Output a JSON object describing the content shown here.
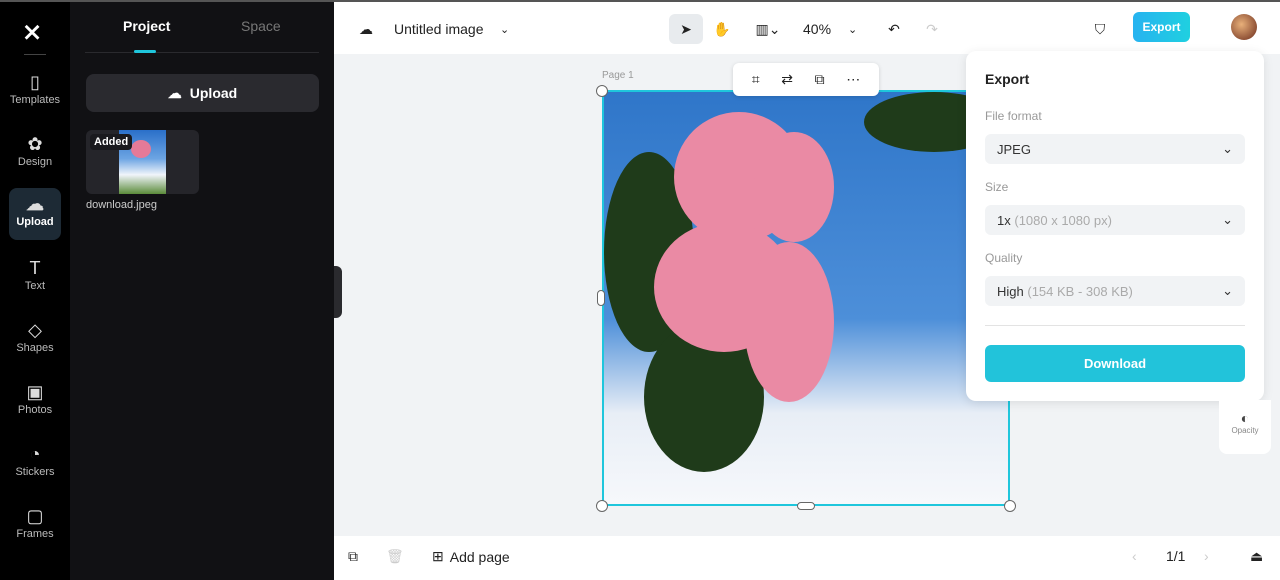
{
  "rail": {
    "items": [
      {
        "label": "Templates",
        "icon": "▯"
      },
      {
        "label": "Design",
        "icon": "✿"
      },
      {
        "label": "Upload",
        "icon": "☁"
      },
      {
        "label": "Text",
        "icon": "T"
      },
      {
        "label": "Shapes",
        "icon": "◇"
      },
      {
        "label": "Photos",
        "icon": "▣"
      },
      {
        "label": "Stickers",
        "icon": "◔"
      },
      {
        "label": "Frames",
        "icon": "▢"
      }
    ]
  },
  "panel": {
    "tabs": [
      "Project",
      "Space"
    ],
    "upload_label": "Upload",
    "asset": {
      "badge": "Added",
      "name": "download.jpeg"
    }
  },
  "toolbar": {
    "title": "Untitled image",
    "zoom": "40%",
    "export_label": "Export"
  },
  "canvas": {
    "page_label": "Page 1"
  },
  "export": {
    "title": "Export",
    "file_format_label": "File format",
    "file_format": "JPEG",
    "size_label": "Size",
    "size": "1x",
    "size_detail": "(1080 x 1080 px)",
    "quality_label": "Quality",
    "quality": "High",
    "quality_detail": "(154 KB - 308 KB)",
    "download_label": "Download"
  },
  "side": {
    "opacity_label": "Opacity"
  },
  "bottom": {
    "add_page": "Add page",
    "page_count": "1/1"
  },
  "colors": {
    "accent": "#1fc6dc"
  }
}
